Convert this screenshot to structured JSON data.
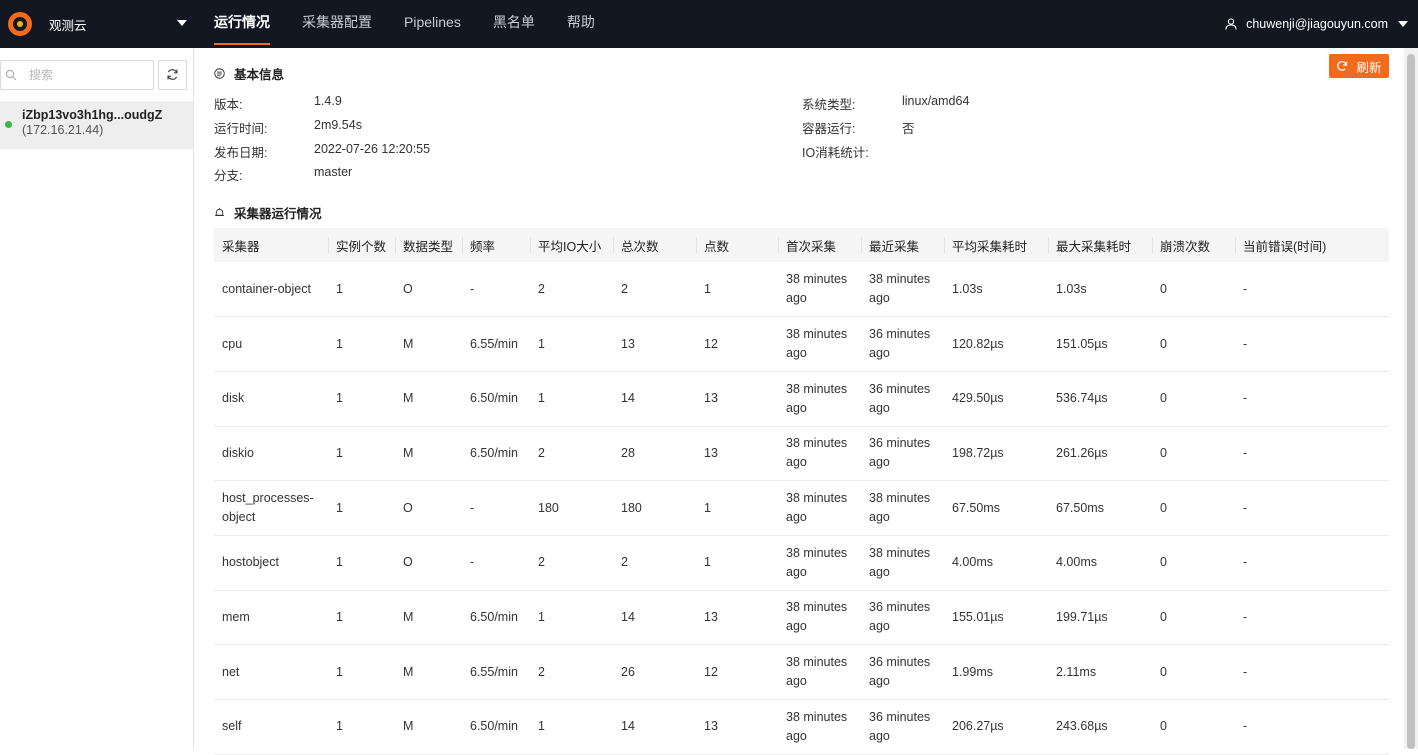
{
  "header": {
    "brand": "观测云",
    "nav": [
      "运行情况",
      "采集器配置",
      "Pipelines",
      "黑名单",
      "帮助"
    ],
    "active_nav": 0,
    "user": "chuwenji@jiagouyun.com"
  },
  "sidebar": {
    "search_placeholder": "搜索",
    "host": {
      "name": "iZbp13vo3h1hg...oudgZ",
      "ip": "(172.16.21.44)",
      "status_color": "#3bb54a"
    }
  },
  "basic": {
    "title": "基本信息",
    "refresh_label": "刷新",
    "left": [
      {
        "label": "版本:",
        "value": "1.4.9"
      },
      {
        "label": "运行时间:",
        "value": "2m9.54s"
      },
      {
        "label": "发布日期:",
        "value": "2022-07-26 12:20:55"
      },
      {
        "label": "分支:",
        "value": "master"
      }
    ],
    "right": [
      {
        "label": "系统类型:",
        "value": "linux/amd64"
      },
      {
        "label": "容器运行:",
        "value": "否"
      },
      {
        "label": "IO消耗统计:",
        "value": ""
      }
    ]
  },
  "inputs": {
    "title": "采集器运行情况",
    "columns": [
      "采集器",
      "实例个数",
      "数据类型",
      "频率",
      "平均IO大小",
      "总次数",
      "点数",
      "首次采集",
      "最近采集",
      "平均采集耗时",
      "最大采集耗时",
      "崩溃次数",
      "当前错误(时间)"
    ],
    "rows": [
      [
        "container-object",
        "1",
        "O",
        "-",
        "2",
        "2",
        "1",
        "38 minutes ago",
        "38 minutes ago",
        "1.03s",
        "1.03s",
        "0",
        "-"
      ],
      [
        "cpu",
        "1",
        "M",
        "6.55/min",
        "1",
        "13",
        "12",
        "38 minutes ago",
        "36 minutes ago",
        "120.82µs",
        "151.05µs",
        "0",
        "-"
      ],
      [
        "disk",
        "1",
        "M",
        "6.50/min",
        "1",
        "14",
        "13",
        "38 minutes ago",
        "36 minutes ago",
        "429.50µs",
        "536.74µs",
        "0",
        "-"
      ],
      [
        "diskio",
        "1",
        "M",
        "6.50/min",
        "2",
        "28",
        "13",
        "38 minutes ago",
        "36 minutes ago",
        "198.72µs",
        "261.26µs",
        "0",
        "-"
      ],
      [
        "host_processes-object",
        "1",
        "O",
        "-",
        "180",
        "180",
        "1",
        "38 minutes ago",
        "38 minutes ago",
        "67.50ms",
        "67.50ms",
        "0",
        "-"
      ],
      [
        "hostobject",
        "1",
        "O",
        "-",
        "2",
        "2",
        "1",
        "38 minutes ago",
        "38 minutes ago",
        "4.00ms",
        "4.00ms",
        "0",
        "-"
      ],
      [
        "mem",
        "1",
        "M",
        "6.50/min",
        "1",
        "14",
        "13",
        "38 minutes ago",
        "36 minutes ago",
        "155.01µs",
        "199.71µs",
        "0",
        "-"
      ],
      [
        "net",
        "1",
        "M",
        "6.55/min",
        "2",
        "26",
        "12",
        "38 minutes ago",
        "36 minutes ago",
        "1.99ms",
        "2.11ms",
        "0",
        "-"
      ],
      [
        "self",
        "1",
        "M",
        "6.50/min",
        "1",
        "14",
        "13",
        "38 minutes ago",
        "36 minutes ago",
        "206.27µs",
        "243.68µs",
        "0",
        "-"
      ]
    ]
  },
  "colors": {
    "accent": "#f26b1d",
    "topbar": "#131722"
  }
}
